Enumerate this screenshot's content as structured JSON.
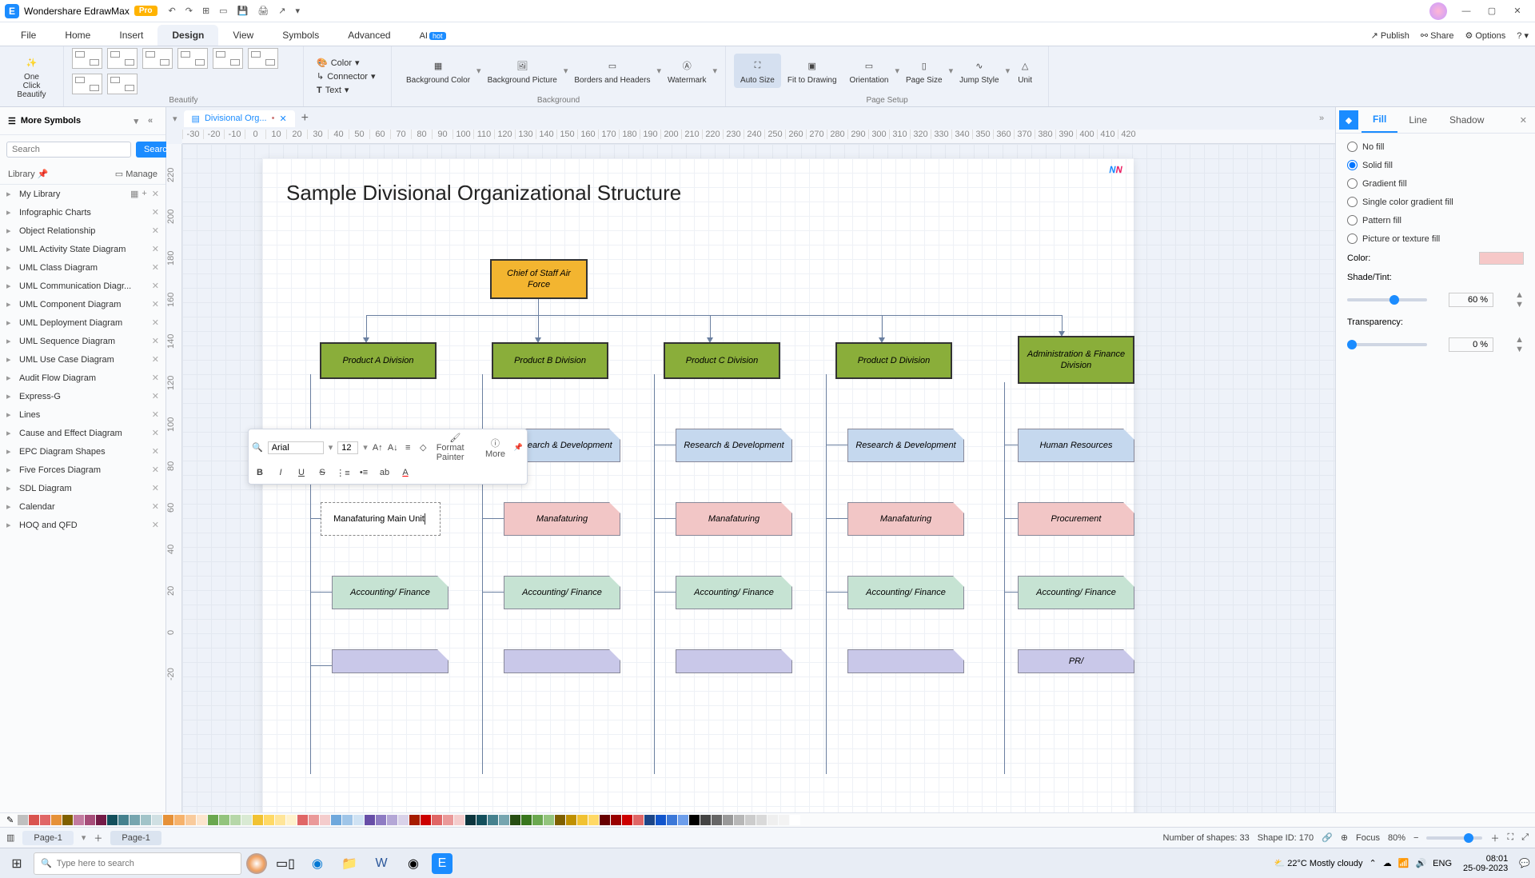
{
  "titlebar": {
    "app": "Wondershare EdrawMax",
    "badge": "Pro"
  },
  "menubar": {
    "items": [
      "File",
      "Home",
      "Insert",
      "Design",
      "View",
      "Symbols",
      "Advanced",
      "AI"
    ],
    "active": 3,
    "hot_index": 7,
    "right": {
      "publish": "Publish",
      "share": "Share",
      "options": "Options"
    }
  },
  "ribbon": {
    "oneclick": "One Click\nBeautify",
    "color": "Color",
    "connector": "Connector",
    "text": "Text",
    "bgcolor": "Background\nColor",
    "bgpic": "Background\nPicture",
    "borders": "Borders and\nHeaders",
    "watermark": "Watermark",
    "autosize": "Auto\nSize",
    "fit": "Fit to\nDrawing",
    "orient": "Orientation",
    "pagesize": "Page\nSize",
    "jump": "Jump\nStyle",
    "unit": "Unit",
    "group_beautify": "Beautify",
    "group_bg": "Background",
    "group_setup": "Page Setup"
  },
  "left": {
    "header": "More Symbols",
    "search_ph": "Search",
    "search_btn": "Search",
    "library": "Library",
    "manage": "Manage",
    "items": [
      {
        "n": "My Library",
        "extra": true
      },
      {
        "n": "Infographic Charts"
      },
      {
        "n": "Object Relationship"
      },
      {
        "n": "UML Activity State Diagram"
      },
      {
        "n": "UML Class Diagram"
      },
      {
        "n": "UML Communication Diagr..."
      },
      {
        "n": "UML Component Diagram"
      },
      {
        "n": "UML Deployment Diagram"
      },
      {
        "n": "UML Sequence Diagram"
      },
      {
        "n": "UML Use Case Diagram"
      },
      {
        "n": "Audit Flow Diagram"
      },
      {
        "n": "Express-G"
      },
      {
        "n": "Lines"
      },
      {
        "n": "Cause and Effect Diagram"
      },
      {
        "n": "EPC Diagram Shapes"
      },
      {
        "n": "Five Forces Diagram"
      },
      {
        "n": "SDL Diagram"
      },
      {
        "n": "Calendar"
      },
      {
        "n": "HOQ and QFD"
      }
    ]
  },
  "doc": {
    "tab": "Divisional Org...",
    "title": "Sample Divisional Organizational Structure",
    "root": "Chief of Staff\nAir Force",
    "divs": [
      "Product A\nDivision",
      "Product B\nDivision",
      "Product C\nDivision",
      "Product D\nDivision",
      "Administration\n& Finance\nDivision"
    ],
    "row_rd": "Research &\nDevelopment",
    "row_mf": "Manafaturing",
    "row_af": "Accounting/\nFinance",
    "row_pr": "PR/",
    "col5": [
      "Human Resources",
      "Procurement",
      "Accounting/\nFinance",
      "PR/"
    ],
    "edit": "Manafaturing Main Unit"
  },
  "floattool": {
    "font": "Arial",
    "size": "12",
    "format": "Format\nPainter",
    "more": "More"
  },
  "right": {
    "tabs": [
      "Fill",
      "Line",
      "Shadow"
    ],
    "active": 0,
    "opts": [
      "No fill",
      "Solid fill",
      "Gradient fill",
      "Single color gradient fill",
      "Pattern fill",
      "Picture or texture fill"
    ],
    "selected": 1,
    "color_lbl": "Color:",
    "shade_lbl": "Shade/Tint:",
    "shade_val": "60 %",
    "trans_lbl": "Transparency:",
    "trans_val": "0 %"
  },
  "hruler": [
    "-30",
    "-20",
    "-10",
    "0",
    "10",
    "20",
    "30",
    "40",
    "50",
    "60",
    "70",
    "80",
    "90",
    "100",
    "110",
    "120",
    "130",
    "140",
    "150",
    "160",
    "170",
    "180",
    "190",
    "200",
    "210",
    "220",
    "230",
    "240",
    "250",
    "260",
    "270",
    "280",
    "290",
    "300",
    "310",
    "320",
    "330",
    "340",
    "350",
    "360",
    "370",
    "380",
    "390",
    "400",
    "410",
    "420"
  ],
  "vruler": [
    "",
    "220",
    "",
    "200",
    "",
    "180",
    "",
    "160",
    "",
    "140",
    "",
    "120",
    "",
    "100",
    "",
    "80",
    "",
    "60",
    "",
    "40",
    "",
    "20",
    "",
    "0",
    "",
    "-20"
  ],
  "status": {
    "page": "Page-1",
    "shapes": "Number of shapes: 33",
    "shapeid": "Shape ID: 170",
    "focus": "Focus",
    "zoom": "80%"
  },
  "palette": [
    "#bfbfbf",
    "#d9534f",
    "#e06666",
    "#e69138",
    "#7f6000",
    "#c27ba0",
    "#a64d79",
    "#741b47",
    "#134f5c",
    "#45818e",
    "#76a5af",
    "#a2c4c9",
    "#d0e0e3",
    "#e69138",
    "#f6b26b",
    "#f9cb9c",
    "#fce5cd",
    "#6aa84f",
    "#93c47d",
    "#b6d7a8",
    "#d9ead3",
    "#f1c232",
    "#ffd966",
    "#ffe599",
    "#fff2cc",
    "#e06666",
    "#ea9999",
    "#f4cccc",
    "#6fa8dc",
    "#9fc5e8",
    "#cfe2f3",
    "#674ea7",
    "#8e7cc3",
    "#b4a7d6",
    "#d9d2e9",
    "#a61c00",
    "#cc0000",
    "#e06666",
    "#ea9999",
    "#f4cccc",
    "#0c343d",
    "#134f5c",
    "#45818e",
    "#76a5af",
    "#274e13",
    "#38761d",
    "#6aa84f",
    "#93c47d",
    "#7f6000",
    "#bf9000",
    "#f1c232",
    "#ffd966",
    "#660000",
    "#990000",
    "#cc0000",
    "#e06666",
    "#1c4587",
    "#1155cc",
    "#3c78d8",
    "#6d9eeb",
    "#000000",
    "#434343",
    "#666666",
    "#999999",
    "#b7b7b7",
    "#cccccc",
    "#d9d9d9",
    "#efefef",
    "#f3f3f3",
    "#ffffff"
  ],
  "taskbar": {
    "search_ph": "Type here to search",
    "weather": "22°C  Mostly cloudy",
    "time": "08:01",
    "date": "25-09-2023"
  }
}
